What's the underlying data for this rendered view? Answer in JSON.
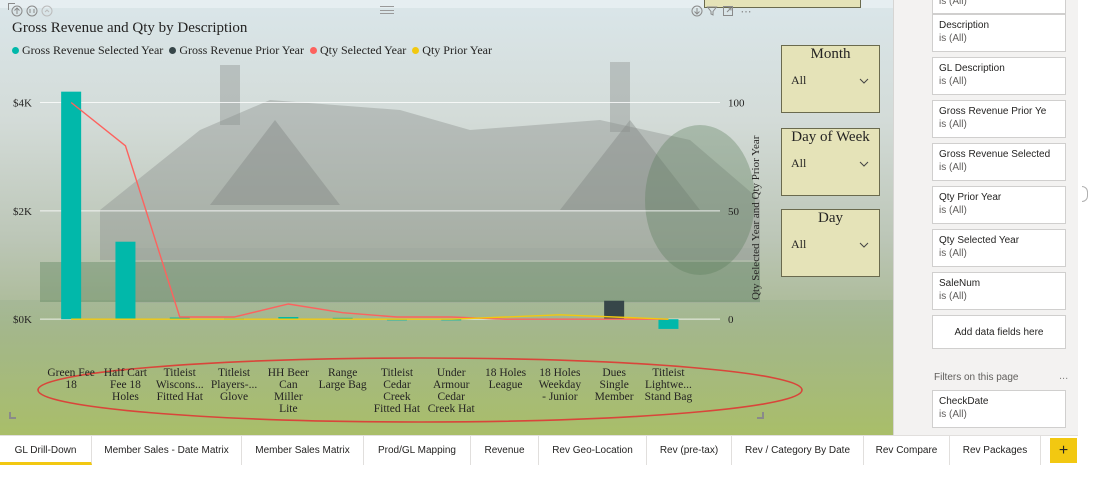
{
  "visual": {
    "title": "Gross Revenue and Qty by Description",
    "header_icons": [
      "arrow-up-icon",
      "drill-down-icon",
      "expand-icon",
      "drill-mode-icon",
      "filter-icon",
      "focus-mode-icon",
      "more-options-icon"
    ],
    "more_options_label": "⋯",
    "legend": [
      {
        "label": "Gross Revenue Selected Year",
        "color": "#01b8aa"
      },
      {
        "label": "Gross Revenue Prior Year",
        "color": "#374649"
      },
      {
        "label": "Qty Selected Year",
        "color": "#fd625e"
      },
      {
        "label": "Qty Prior Year",
        "color": "#f2c80f"
      }
    ]
  },
  "chart_data": {
    "type": "bar",
    "categories": [
      "Green Fee 18",
      "Half Cart Fee 18 Holes",
      "Titleist Wiscons... Fitted Hat",
      "Titleist Players-... Glove",
      "HH Beer Can Miller Lite",
      "Range Large Bag",
      "Titleist Cedar Creek Fitted Hat",
      "Under Armour Cedar Creek Hat",
      "18 Holes League",
      "18 Holes Weekday - Junior",
      "Dues Single Member",
      "Titleist Lightwe... Stand Bag"
    ],
    "category_lines": [
      [
        "Green Fee",
        "18"
      ],
      [
        "Half Cart",
        "Fee 18",
        "Holes"
      ],
      [
        "Titleist",
        "Wiscons...",
        "Fitted Hat"
      ],
      [
        "Titleist",
        "Players-...",
        "Glove"
      ],
      [
        "HH Beer",
        "Can",
        "Miller",
        "Lite"
      ],
      [
        "Range",
        "Large Bag"
      ],
      [
        "Titleist",
        "Cedar",
        "Creek",
        "Fitted Hat"
      ],
      [
        "Under",
        "Armour",
        "Cedar",
        "Creek Hat"
      ],
      [
        "18 Holes",
        "League"
      ],
      [
        "18 Holes",
        "Weekday",
        "- Junior"
      ],
      [
        "Dues",
        "Single",
        "Member"
      ],
      [
        "Titleist",
        "Lightwe...",
        "Stand Bag"
      ]
    ],
    "series": [
      {
        "name": "Gross Revenue Selected Year",
        "axis": "left",
        "values": [
          4200,
          1430,
          30,
          15,
          40,
          25,
          5,
          5,
          0,
          0,
          0,
          -180
        ]
      },
      {
        "name": "Gross Revenue Prior Year",
        "axis": "left",
        "values": [
          0,
          0,
          0,
          0,
          0,
          0,
          0,
          0,
          0,
          0,
          340,
          0
        ]
      },
      {
        "name": "Qty Selected Year",
        "axis": "right",
        "values": [
          100,
          80,
          1,
          1,
          7,
          3,
          1,
          1,
          0,
          0,
          0,
          0
        ]
      },
      {
        "name": "Qty Prior Year",
        "axis": "right",
        "values": [
          0,
          0,
          0,
          0,
          0,
          0,
          0,
          0,
          1,
          2,
          1,
          0
        ]
      }
    ],
    "left_axis": {
      "range": [
        -200,
        4600
      ],
      "ticks": [
        0,
        2000,
        4000
      ],
      "tick_labels": [
        "$0K",
        "$2K",
        "$4K"
      ]
    },
    "right_axis": {
      "label": "Qty Selected Year and Qty Prior Year",
      "range": [
        -5,
        115
      ],
      "ticks": [
        0,
        50,
        100
      ],
      "tick_labels": [
        "0",
        "50",
        "100"
      ]
    },
    "grid": true,
    "legend_position": "top-left"
  },
  "slicers": [
    {
      "title": "Month",
      "value": "All"
    },
    {
      "title": "Day of Week",
      "value": "All"
    },
    {
      "title": "Day",
      "value": "All"
    }
  ],
  "filters_pane": {
    "cards": [
      {
        "name": "",
        "value": "is (All)"
      },
      {
        "name": "Description",
        "value": "is (All)"
      },
      {
        "name": "GL Description",
        "value": "is (All)"
      },
      {
        "name": "Gross Revenue Prior Ye",
        "value": "is (All)"
      },
      {
        "name": "Gross Revenue Selected",
        "value": "is (All)"
      },
      {
        "name": "Qty Prior Year",
        "value": "is (All)"
      },
      {
        "name": "Qty Selected Year",
        "value": "is (All)"
      },
      {
        "name": "SaleNum",
        "value": "is (All)"
      }
    ],
    "add_fields_label": "Add data fields here",
    "section_label": "Filters on this page",
    "section_more": "...",
    "page_cards": [
      {
        "name": "CheckDate",
        "value": "is (All)"
      }
    ]
  },
  "tabs": [
    {
      "label": "GL Drill-Down",
      "active": true
    },
    {
      "label": "Member Sales - Date Matrix",
      "active": false
    },
    {
      "label": "Member Sales Matrix",
      "active": false
    },
    {
      "label": "Prod/GL Mapping",
      "active": false
    },
    {
      "label": "Revenue",
      "active": false
    },
    {
      "label": "Rev Geo-Location",
      "active": false
    },
    {
      "label": "Rev (pre-tax)",
      "active": false
    },
    {
      "label": "Rev / Category By Date",
      "active": false
    },
    {
      "label": "Rev Compare",
      "active": false
    },
    {
      "label": "Rev Packages",
      "active": false
    }
  ],
  "add_tab_label": "+",
  "annotation_color": "#d9453a"
}
